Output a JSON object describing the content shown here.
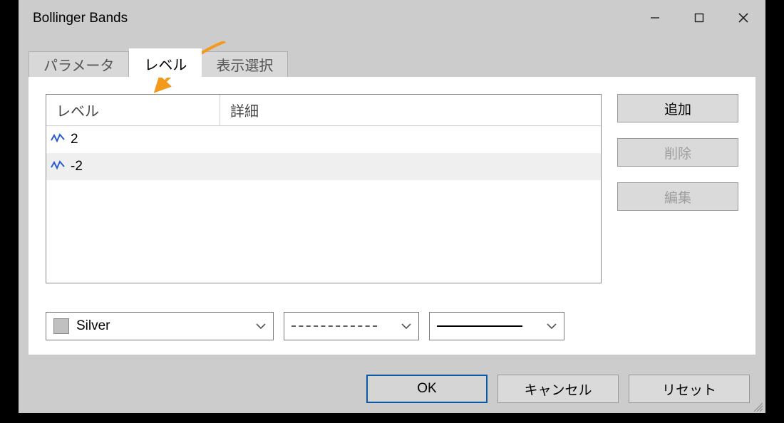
{
  "window": {
    "title": "Bollinger Bands"
  },
  "tabs": [
    {
      "label": "パラメータ",
      "active": false
    },
    {
      "label": "レベル",
      "active": true
    },
    {
      "label": "表示選択",
      "active": false
    }
  ],
  "table": {
    "columns": {
      "level": "レベル",
      "detail": "詳細"
    },
    "rows": [
      {
        "level": "2",
        "detail": "",
        "selected": false
      },
      {
        "level": "-2",
        "detail": "",
        "selected": true
      }
    ]
  },
  "side_buttons": {
    "add": {
      "label": "追加",
      "enabled": true
    },
    "delete": {
      "label": "削除",
      "enabled": false
    },
    "edit": {
      "label": "編集",
      "enabled": false
    }
  },
  "style": {
    "color_name": "Silver",
    "color_hex": "#c0c0c0"
  },
  "footer": {
    "ok": "OK",
    "cancel": "キャンセル",
    "reset": "リセット"
  }
}
